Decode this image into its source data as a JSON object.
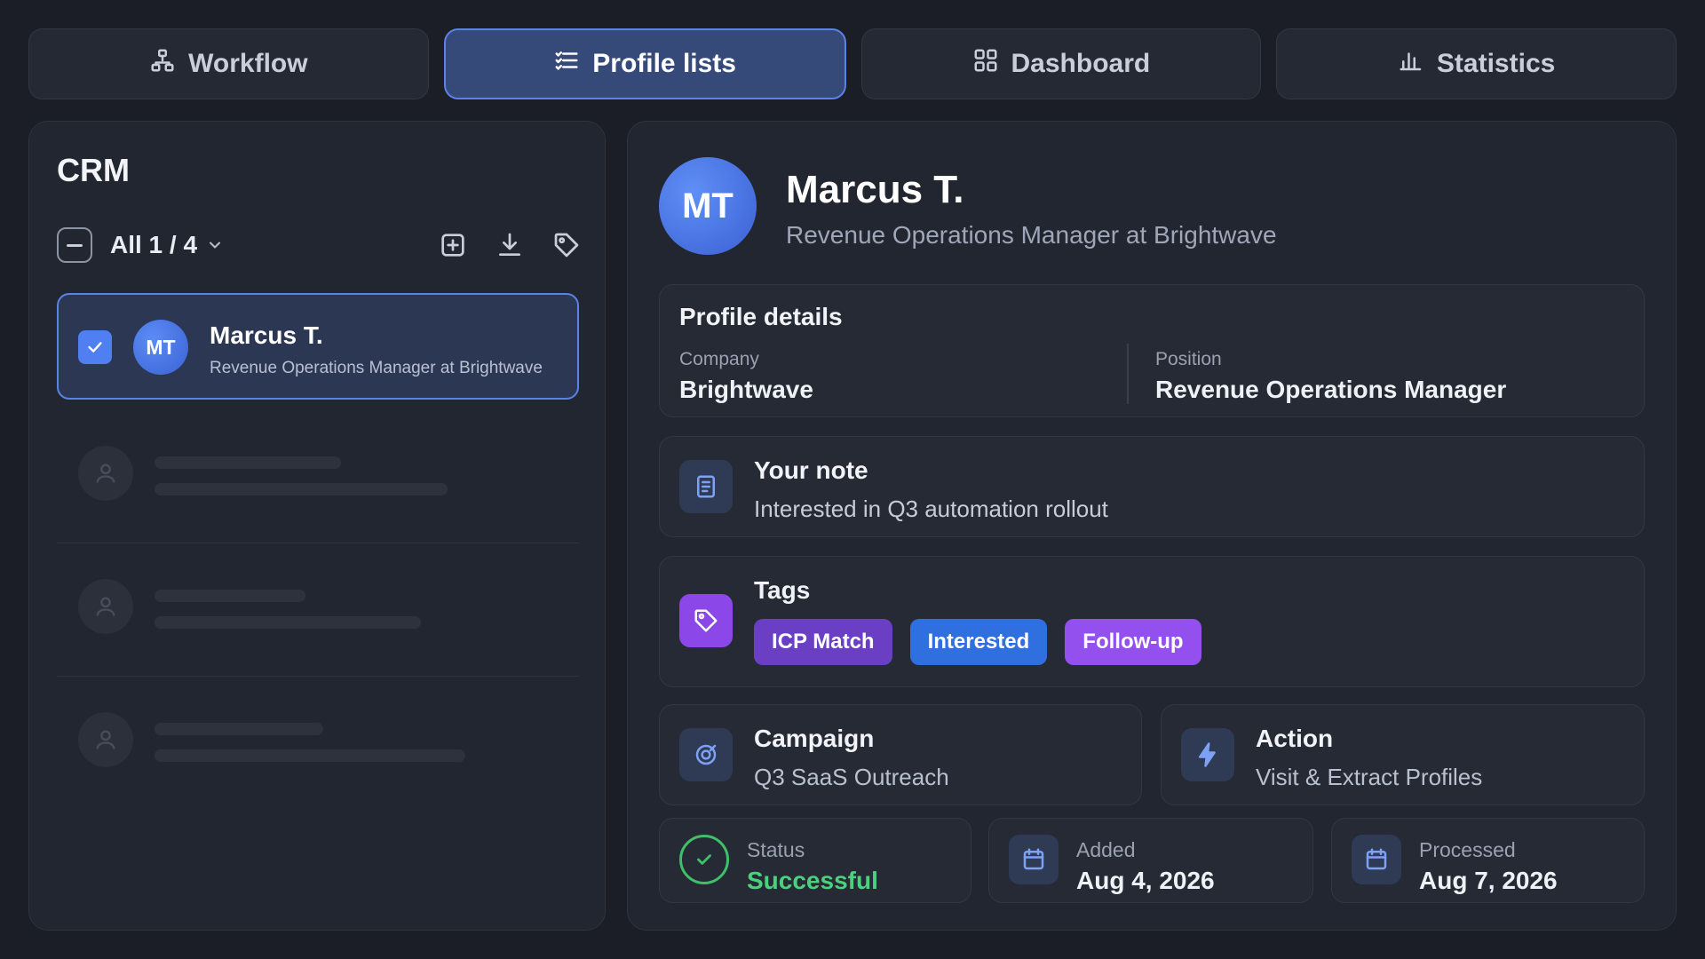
{
  "tabs": [
    {
      "label": "Workflow",
      "icon": "workflow-icon",
      "active": false
    },
    {
      "label": "Profile lists",
      "icon": "list-icon",
      "active": true
    },
    {
      "label": "Dashboard",
      "icon": "grid-icon",
      "active": false
    },
    {
      "label": "Statistics",
      "icon": "bar-chart-icon",
      "active": false
    }
  ],
  "crm": {
    "title": "CRM",
    "selection_label": "All 1 / 4",
    "toolbar_icons": [
      "add-square-icon",
      "download-icon",
      "tag-icon"
    ],
    "selected_profile": {
      "initials": "MT",
      "name": "Marcus T.",
      "headline": "Revenue Operations Manager at Brightwave",
      "checked": true
    },
    "placeholder_rows": 3
  },
  "profile": {
    "initials": "MT",
    "name": "Marcus T.",
    "headline": "Revenue Operations Manager at Brightwave",
    "details": {
      "title": "Profile details",
      "company_label": "Company",
      "company": "Brightwave",
      "position_label": "Position",
      "position": "Revenue Operations Manager"
    },
    "note": {
      "title": "Your note",
      "text": "Interested in Q3 automation rollout"
    },
    "tags": {
      "title": "Tags",
      "items": [
        {
          "label": "ICP Match",
          "color": "#6a3fc4"
        },
        {
          "label": "Interested",
          "color": "#2f6fe0"
        },
        {
          "label": "Follow-up",
          "color": "#9450ef"
        }
      ]
    },
    "campaign": {
      "title": "Campaign",
      "value": "Q3 SaaS Outreach"
    },
    "action": {
      "title": "Action",
      "value": "Visit & Extract Profiles"
    },
    "status": {
      "label": "Status",
      "value": "Successful",
      "color": "#4cd07d"
    },
    "added": {
      "label": "Added",
      "value": "Aug 4, 2026"
    },
    "processed": {
      "label": "Processed",
      "value": "Aug 7, 2026"
    }
  },
  "colors": {
    "accent": "#5b82e6",
    "background": "#1b1e26",
    "panel": "#222630",
    "success": "#4cd07d"
  }
}
